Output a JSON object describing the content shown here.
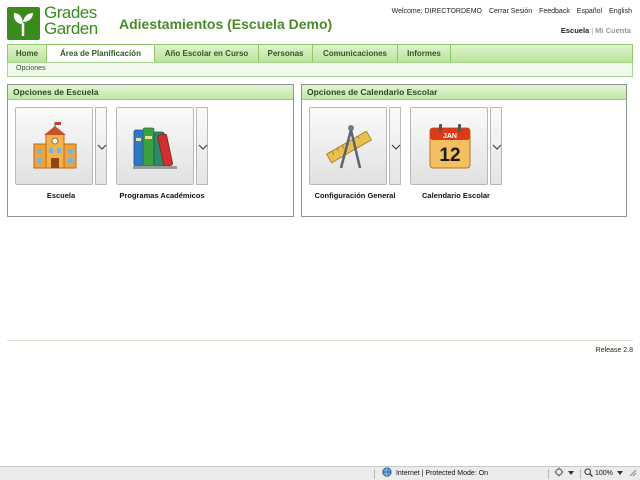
{
  "header": {
    "logo_text_line1": "Grades",
    "logo_text_line2": "Garden",
    "school_title": "Adiestamientos (Escuela Demo)",
    "welcome": "Welcome: DIRECTORDEMO",
    "links": [
      "Cerrar Sesión",
      "Feedback",
      "Español",
      "English"
    ],
    "account_current": "Escuela",
    "account_other": "Mi Cuenta"
  },
  "nav": {
    "tabs": [
      "Home",
      "Área de Planificación",
      "Año Escolar en Curso",
      "Personas",
      "Comunicaciones",
      "Informes"
    ],
    "active_index": 1,
    "subnav": [
      "Opciones"
    ]
  },
  "panels": [
    {
      "title": "Opciones de Escuela",
      "tiles": [
        {
          "label": "Escuela",
          "icon": "school-building-icon"
        },
        {
          "label": "Programas Académicos",
          "icon": "books-icon"
        }
      ]
    },
    {
      "title": "Opciones de Calendario Escolar",
      "tiles": [
        {
          "label": "Configuración General",
          "icon": "compass-ruler-icon"
        },
        {
          "label": "Calendario Escolar",
          "icon": "calendar-icon"
        }
      ]
    }
  ],
  "calendar_icon": {
    "month": "JAN",
    "day": "12"
  },
  "footer": {
    "release": "Release 2.8"
  },
  "statusbar": {
    "zone": "Internet | Protected Mode: On",
    "zoom": "100%"
  },
  "colors": {
    "brand_green": "#3a8a1e",
    "nav_green": "#b9e39b",
    "title_green": "#4a8a2a"
  }
}
